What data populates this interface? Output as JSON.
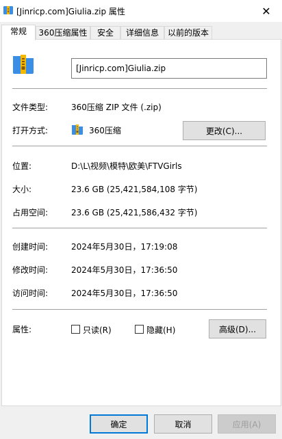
{
  "window": {
    "title": "[Jinricp.com]Giulia.zip 属性",
    "close_glyph": "✕"
  },
  "tabs": [
    {
      "label": "常规",
      "active": true
    },
    {
      "label": "360压缩属性",
      "active": false
    },
    {
      "label": "安全",
      "active": false
    },
    {
      "label": "详细信息",
      "active": false
    },
    {
      "label": "以前的版本",
      "active": false
    }
  ],
  "general": {
    "file_name": "[Jinricp.com]Giulia.zip",
    "type_label": "文件类型:",
    "type_value": "360压缩 ZIP 文件 (.zip)",
    "open_with_label": "打开方式:",
    "open_with_value": "360压缩",
    "change_button": "更改(C)...",
    "location_label": "位置:",
    "location_value": "D:\\L\\视频\\模特\\欧美\\FTVGirls",
    "size_label": "大小:",
    "size_value": "23.6 GB (25,421,584,108 字节)",
    "size_on_disk_label": "占用空间:",
    "size_on_disk_value": "23.6 GB (25,421,586,432 字节)",
    "created_label": "创建时间:",
    "created_value": "2024年5月30日，17:19:08",
    "modified_label": "修改时间:",
    "modified_value": "2024年5月30日，17:36:50",
    "accessed_label": "访问时间:",
    "accessed_value": "2024年5月30日，17:36:50",
    "attributes_label": "属性:",
    "readonly_label": "只读(R)",
    "hidden_label": "隐藏(H)",
    "advanced_button": "高级(D)..."
  },
  "footer": {
    "ok": "确定",
    "cancel": "取消",
    "apply": "应用(A)"
  },
  "colors": {
    "accent": "#0078d7",
    "zip_icon_blue": "#3a8ee6",
    "zip_icon_yellow": "#f5b800"
  }
}
